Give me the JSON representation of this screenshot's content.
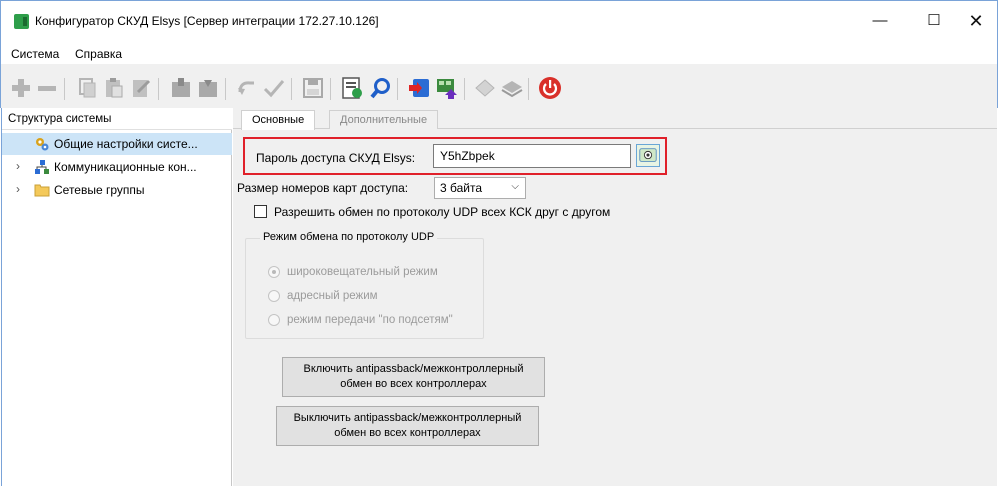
{
  "window": {
    "title": "Конфигуратор СКУД Elsys [Сервер интеграции 172.27.10.126]",
    "minimize": "—",
    "maximize": "☐",
    "close": "✕"
  },
  "menu": {
    "items": [
      "Система",
      "Справка"
    ]
  },
  "toolbar": {
    "icons": [
      "add-icon",
      "remove-icon",
      "copy-icon",
      "paste-icon",
      "clear-icon",
      "upload-icon",
      "download-icon",
      "undo-icon",
      "apply-icon",
      "save-icon",
      "properties-icon",
      "search-icon",
      "import-icon",
      "export-icon",
      "diamond-icon",
      "layer-icon",
      "power-icon"
    ]
  },
  "tree": {
    "header": "Структура системы",
    "items": [
      {
        "label": "Общие настройки систе...",
        "icon": "gears-icon",
        "selected": true
      },
      {
        "label": "Коммуникационные кон...",
        "icon": "network-icon",
        "selected": false
      },
      {
        "label": "Сетевые группы",
        "icon": "folder-icon",
        "selected": false
      }
    ]
  },
  "tabs": {
    "main": "Основные",
    "extra": "Дополнительные"
  },
  "settings": {
    "password_label": "Пароль доступа СКУД Elsys:",
    "password_value": "Y5hZbpek",
    "cards_label": "Размер номеров карт доступа:",
    "cards_value": "3 байта",
    "udp_checkbox_label": "Разрешить обмен по протоколу UDP всех КСК друг с другом",
    "udp_checked": false,
    "udp_group_title": "Режим обмена по протоколу UDP",
    "udp_modes": [
      {
        "label": "широковещательный режим",
        "checked": true
      },
      {
        "label": "адресный режим",
        "checked": false
      },
      {
        "label": "режим передачи \"по подсетям\"",
        "checked": false
      }
    ]
  },
  "buttons": {
    "enable_line1": "Включить antipassback/межконтроллерный",
    "enable_line2": "обмен во всех контроллерах",
    "disable_line1": "Выключить antipassback/межконтроллерный",
    "disable_line2": "обмен во всех контроллерах"
  },
  "colors": {
    "highlight_border": "#e0202a",
    "selection": "#cce4f7",
    "power": "#d9302a"
  }
}
